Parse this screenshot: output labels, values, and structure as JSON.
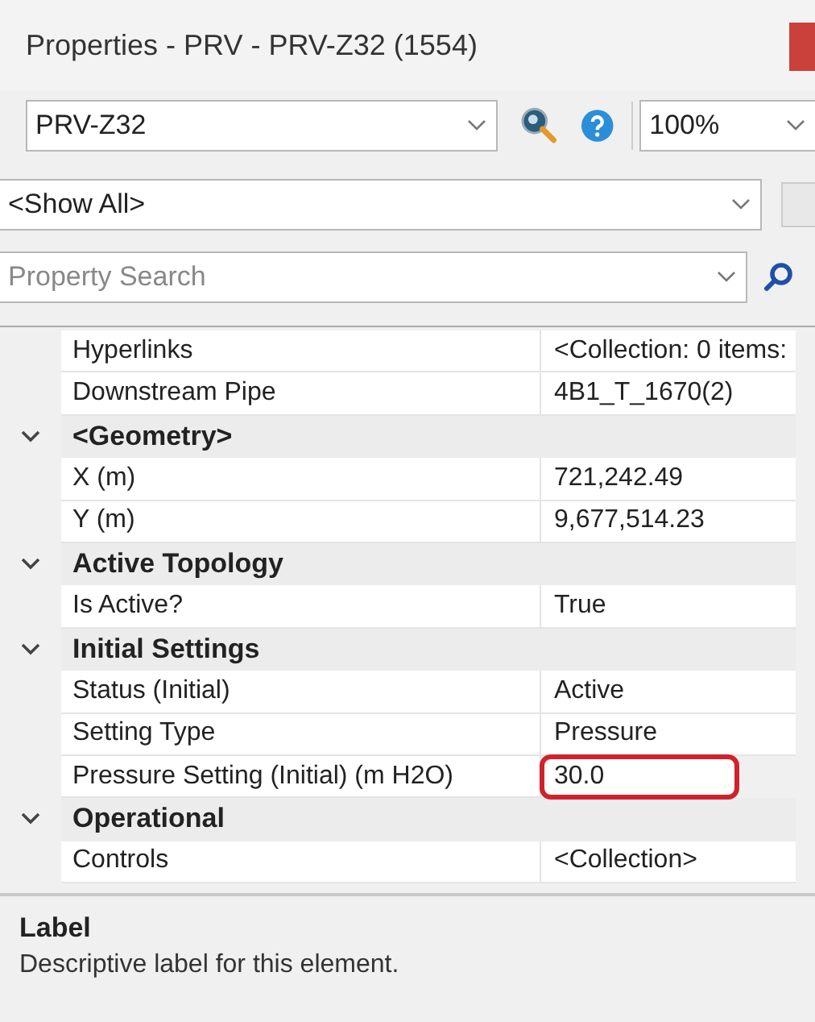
{
  "window": {
    "title": "Properties - PRV - PRV-Z32 (1554)"
  },
  "toolbar": {
    "element_selector": {
      "value": "PRV-Z32"
    },
    "zoom": {
      "value": "100%"
    }
  },
  "filter": {
    "value": "<Show All>"
  },
  "search": {
    "placeholder": "Property Search"
  },
  "grid": {
    "rows": [
      {
        "kind": "property",
        "label": "Hyperlinks",
        "value": "<Collection: 0 items:",
        "highlighted": false
      },
      {
        "kind": "property",
        "label": "Downstream Pipe",
        "value": "4B1_T_1670(2)",
        "highlighted": false
      },
      {
        "kind": "category",
        "label": "<Geometry>",
        "expanded": true
      },
      {
        "kind": "property",
        "label": "X (m)",
        "value": "721,242.49",
        "highlighted": false
      },
      {
        "kind": "property",
        "label": "Y (m)",
        "value": "9,677,514.23",
        "highlighted": false
      },
      {
        "kind": "category",
        "label": "Active Topology",
        "expanded": true
      },
      {
        "kind": "property",
        "label": "Is Active?",
        "value": "True",
        "highlighted": false
      },
      {
        "kind": "category",
        "label": "Initial Settings",
        "expanded": true
      },
      {
        "kind": "property",
        "label": "Status (Initial)",
        "value": "Active",
        "highlighted": false
      },
      {
        "kind": "property",
        "label": "Setting Type",
        "value": "Pressure",
        "highlighted": false
      },
      {
        "kind": "property",
        "label": "Pressure Setting (Initial) (m H2O)",
        "value": "30.0",
        "highlighted": true
      },
      {
        "kind": "category",
        "label": "Operational",
        "expanded": true
      },
      {
        "kind": "property",
        "label": "Controls",
        "value": "<Collection>",
        "highlighted": false
      }
    ]
  },
  "description": {
    "title": "Label",
    "text": "Descriptive label for this element."
  }
}
